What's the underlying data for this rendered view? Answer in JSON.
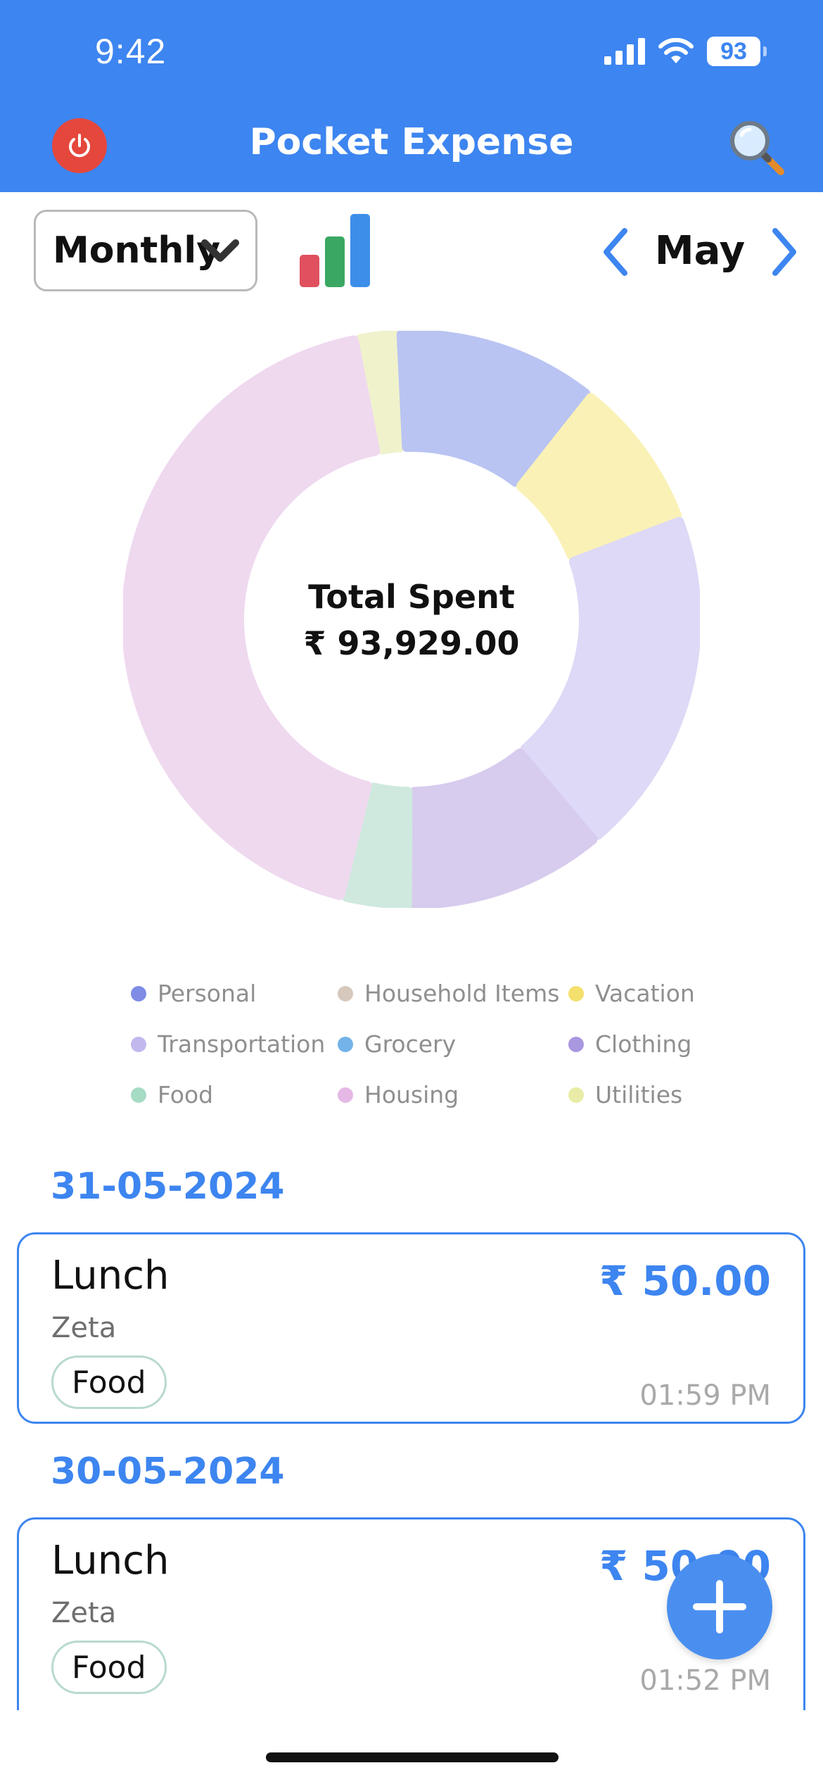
{
  "status_bar": {
    "time": "9:42",
    "battery": "93"
  },
  "header": {
    "title": "Pocket Expense"
  },
  "controls": {
    "period": "Monthly",
    "month": "May"
  },
  "chart_data": {
    "type": "pie",
    "center_label": "Total Spent",
    "center_value": "₹ 93,929.00",
    "slices": [
      {
        "name": "Utilities",
        "value": 2.3,
        "color": "#f0f2cc"
      },
      {
        "name": "Personal",
        "value": 11.4,
        "color": "#b9c4f2"
      },
      {
        "name": "Vacation",
        "value": 8.6,
        "color": "#faf1b6"
      },
      {
        "name": "Transportation",
        "value": 19.6,
        "color": "#ddd9f6"
      },
      {
        "name": "Clothing",
        "value": 11.2,
        "color": "#d7cbee"
      },
      {
        "name": "Food",
        "value": 3.8,
        "color": "#cfe9de"
      },
      {
        "name": "Housing",
        "value": 43.1,
        "color": "#efd9ef"
      }
    ]
  },
  "legend": [
    {
      "label": "Personal",
      "color": "#7e8ce6"
    },
    {
      "label": "Household Items",
      "color": "#d6c8bd"
    },
    {
      "label": "Vacation",
      "color": "#f3e06d"
    },
    {
      "label": "Transportation",
      "color": "#c3b8ee"
    },
    {
      "label": "Grocery",
      "color": "#74b2ea"
    },
    {
      "label": "Clothing",
      "color": "#a997e0"
    },
    {
      "label": "Food",
      "color": "#a6dbc4"
    },
    {
      "label": "Housing",
      "color": "#e5b8e6"
    },
    {
      "label": "Utilities",
      "color": "#e8eca6"
    }
  ],
  "groups": [
    {
      "date": "31-05-2024",
      "entry": {
        "title": "Lunch",
        "merchant": "Zeta",
        "category": "Food",
        "amount": "₹ 50.00",
        "time": "01:59 PM"
      }
    },
    {
      "date": "30-05-2024",
      "entry": {
        "title": "Lunch",
        "merchant": "Zeta",
        "category": "Food",
        "amount": "₹ 50.00",
        "time": "01:52 PM"
      }
    }
  ]
}
